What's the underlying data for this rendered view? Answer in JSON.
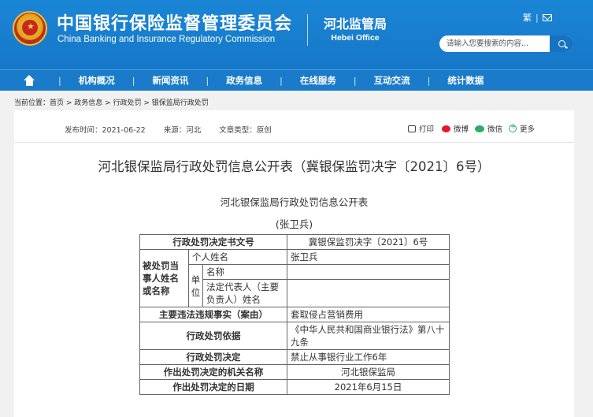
{
  "header": {
    "title_cn": "中国银行保险监督管理委员会",
    "title_en": "China Banking and Insurance Regulatory Commission",
    "bureau_cn": "河北监管局",
    "bureau_en": "Hebei Office",
    "traditional_link": "繁",
    "search": {
      "placeholder": "请输入您要搜索的内容..."
    }
  },
  "nav": {
    "items": [
      "机构概况",
      "新闻资讯",
      "政务信息",
      "在线服务",
      "互动交流",
      "统计数据"
    ]
  },
  "breadcrumb": "当前位置：首页 > 政务信息 > 行政处罚 > 银保监局行政处罚",
  "meta": {
    "publish_time": "发布时间：2021-06-22",
    "source": "来源：河北",
    "doc_type": "文章类型：原创"
  },
  "tools": {
    "print": "打印",
    "weibo": "微博",
    "wechat": "微信",
    "more": "更多"
  },
  "article": {
    "title": "河北银保监局行政处罚信息公开表（冀银保监罚决字〔2021〕6号）",
    "subtitle": "河北银保监局行政处罚信息公开表",
    "person": "(张卫兵)"
  },
  "table": {
    "doc_no_label": "行政处罚决定书文号",
    "doc_no_value": "冀银保监罚决字〔2021〕6号",
    "party_label": "被处罚当事人姓名或名称",
    "individual_label": "个人姓名",
    "individual_value": "张卫兵",
    "unit_label": "单位",
    "unit_name_label": "名称",
    "unit_name_value": "",
    "legal_rep_label": "法定代表人（主要负责人）姓名",
    "legal_rep_value": "",
    "facts_label": "主要违法违规事实（案由）",
    "facts_value": "套取侵占营销费用",
    "basis_label": "行政处罚依据",
    "basis_value": "《中华人民共和国商业银行法》第八十九条",
    "decision_label": "行政处罚决定",
    "decision_value": "禁止从事银行业工作6年",
    "authority_label": "作出处罚决定的机关名称",
    "authority_value": "河北银保监局",
    "date_label": "作出处罚决定的日期",
    "date_value": "2021年6月15日"
  },
  "colors": {
    "header_blue": "#1677c7",
    "nav_blue": "#1a7bcb",
    "weibo_red": "#e6162d",
    "wechat_green": "#2aae67"
  }
}
